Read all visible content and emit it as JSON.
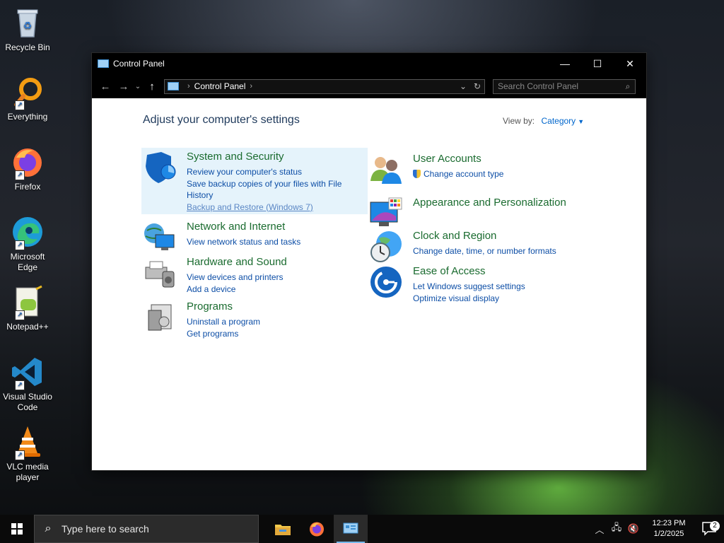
{
  "desktop": {
    "icons": [
      {
        "label": "Recycle Bin"
      },
      {
        "label": "Everything"
      },
      {
        "label": "Firefox"
      },
      {
        "label": "Microsoft Edge"
      },
      {
        "label": "Notepad++"
      },
      {
        "label": "Visual Studio Code"
      },
      {
        "label": "VLC media player"
      }
    ]
  },
  "window": {
    "title": "Control Panel",
    "address": {
      "crumb": "Control Panel"
    },
    "search_placeholder": "Search Control Panel",
    "heading": "Adjust your computer's settings",
    "view_by_label": "View by:",
    "view_by_value": "Category",
    "categories": [
      {
        "title": "System and Security",
        "icon": "shield-icon",
        "links": [
          "Review your computer's status",
          "Save backup copies of your files with File History",
          "Backup and Restore (Windows 7)"
        ]
      },
      {
        "title": "Network and Internet",
        "icon": "network-icon",
        "links": [
          "View network status and tasks"
        ]
      },
      {
        "title": "Hardware and Sound",
        "icon": "printer-icon",
        "links": [
          "View devices and printers",
          "Add a device"
        ]
      },
      {
        "title": "Programs",
        "icon": "programs-icon",
        "links": [
          "Uninstall a program",
          "Get programs"
        ]
      },
      {
        "title": "User Accounts",
        "icon": "users-icon",
        "links": [
          "Change account type"
        ]
      },
      {
        "title": "Appearance and Personalization",
        "icon": "display-icon",
        "links": []
      },
      {
        "title": "Clock and Region",
        "icon": "clock-globe-icon",
        "links": [
          "Change date, time, or number formats"
        ]
      },
      {
        "title": "Ease of Access",
        "icon": "ease-of-access-icon",
        "links": [
          "Let Windows suggest settings",
          "Optimize visual display"
        ]
      }
    ]
  },
  "taskbar": {
    "search_placeholder": "Type here to search",
    "time": "12:23 PM",
    "date": "1/2/2025",
    "notification_count": "2"
  },
  "colors": {
    "category_title": "#1a6b2f",
    "link": "#0d4ea6",
    "heading": "#1e395b",
    "highlight": "#e5f3fb"
  }
}
